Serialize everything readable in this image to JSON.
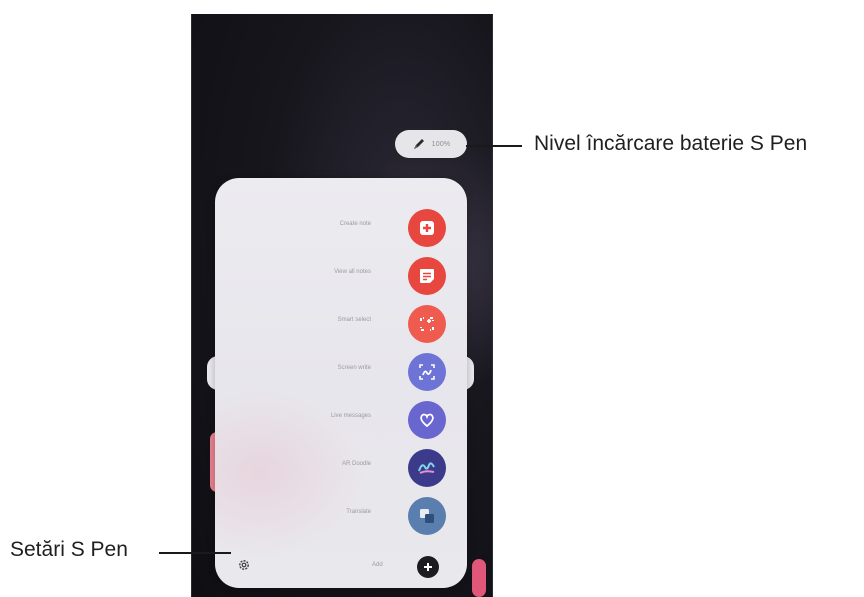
{
  "battery": {
    "percent_label": "100%"
  },
  "menu": {
    "items": [
      {
        "label": "Create note",
        "icon": "create-note-icon",
        "color": "#e8473f"
      },
      {
        "label": "View all notes",
        "icon": "view-notes-icon",
        "color": "#e8473f"
      },
      {
        "label": "Smart select",
        "icon": "smart-select-icon",
        "color": "#ef5c4f"
      },
      {
        "label": "Screen write",
        "icon": "screen-write-icon",
        "color": "#6e74d6"
      },
      {
        "label": "Live messages",
        "icon": "live-messages-icon",
        "color": "#6a66cf"
      },
      {
        "label": "AR Doodle",
        "icon": "ar-doodle-icon",
        "color": "#3c3a8a"
      },
      {
        "label": "Translate",
        "icon": "translate-icon",
        "color": "#5a7fae"
      }
    ],
    "add_label": "Add"
  },
  "callouts": {
    "battery": "Nivel încărcare baterie S Pen",
    "settings": "Setări S Pen"
  }
}
